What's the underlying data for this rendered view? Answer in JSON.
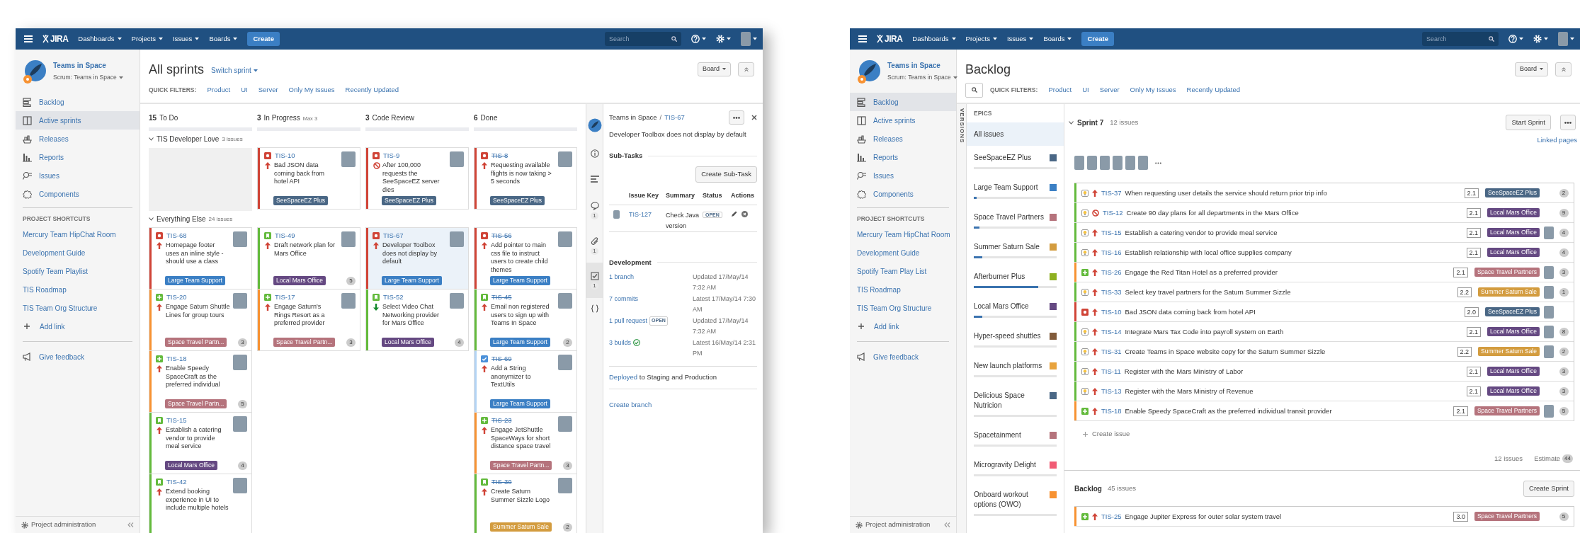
{
  "board_view": {
    "nav": {
      "logo": "JIRA",
      "menus": [
        "Dashboards",
        "Projects",
        "Issues",
        "Boards"
      ],
      "create_button": "Create",
      "search_placeholder": "Search"
    },
    "sidebar": {
      "project_name": "Teams in Space",
      "board_name": "Scrum: Teams in Space",
      "items": [
        {
          "kind": "backlog",
          "label": "Backlog",
          "selected": false
        },
        {
          "kind": "sprints",
          "label": "Active sprints",
          "selected": true
        },
        {
          "kind": "releases",
          "label": "Releases",
          "selected": false
        },
        {
          "kind": "reports",
          "label": "Reports",
          "selected": false
        },
        {
          "kind": "issues",
          "label": "Issues",
          "selected": false
        },
        {
          "kind": "components",
          "label": "Components",
          "selected": false
        }
      ],
      "shortcuts_heading": "PROJECT SHORTCUTS",
      "shortcuts": [
        "Mercury Team HipChat Room",
        "Development Guide",
        "Spotify Team Playlist",
        "TIS Roadmap",
        "TIS Team Org Structure"
      ],
      "add_link": "Add link",
      "feedback": "Give feedback",
      "admin": "Project administration"
    },
    "header": {
      "title": "All sprints",
      "switcher": "Switch sprint",
      "quick_filters_label": "QUICK FILTERS:",
      "quick_filters": [
        "Product",
        "UI",
        "Server",
        "Only My Issues",
        "Recently Updated"
      ],
      "board_button": "Board"
    },
    "columns": [
      {
        "count": "15",
        "name": "To Do"
      },
      {
        "count": "3",
        "name": "In Progress",
        "limit": "Max 3"
      },
      {
        "count": "3",
        "name": "Code Review"
      },
      {
        "count": "6",
        "name": "Done"
      }
    ],
    "swimlanes": [
      {
        "name": "TIS Developer Love",
        "count": "3 issues",
        "expanded": true,
        "cells": [
          [],
          [
            {
              "key": "TIS-10",
              "kind": "bug",
              "priority": {
                "kind": "up"
              },
              "summary": "Bad JSON data coming back from hotel API",
              "epic": {
                "label": "SeeSpaceEZ Plus",
                "color": "#4a6785"
              },
              "color": "#d04437",
              "selected": false,
              "resolved": false
            }
          ],
          [
            {
              "key": "TIS-9",
              "kind": "bug",
              "priority": {
                "kind": "blocker"
              },
              "summary": "After 100,000 requests the SeeSpaceEZ server dies",
              "epic": {
                "label": "SeeSpaceEZ Plus",
                "color": "#4a6785"
              },
              "color": "#d04437",
              "selected": false,
              "resolved": false
            }
          ],
          [
            {
              "key": "TIS-8",
              "kind": "bug",
              "priority": {
                "kind": "up"
              },
              "summary": "Requesting available flights is now taking > 5 seconds",
              "epic": {
                "label": "SeeSpaceEZ Plus",
                "color": "#4a6785"
              },
              "color": "#d04437",
              "selected": false,
              "resolved": true
            }
          ]
        ]
      },
      {
        "name": "Everything Else",
        "count": "24 issues",
        "expanded": true,
        "cells": [
          [
            {
              "key": "TIS-68",
              "kind": "bug",
              "priority": {
                "kind": "up"
              },
              "summary": "Homepage footer uses an inline style - should use a class",
              "epic": {
                "label": "Large Team Support",
                "color": "#3b7fc4"
              },
              "color": "#d04437",
              "selected": false,
              "resolved": false
            },
            {
              "key": "TIS-20",
              "kind": "newfeature",
              "priority": {
                "kind": "up"
              },
              "summary": "Engage Saturn Shuttle Lines for group tours",
              "epic": {
                "label": "Space Travel Partn...",
                "color": "#b5737c"
              },
              "estimate": "3",
              "color": "#f79232",
              "selected": false,
              "resolved": false
            },
            {
              "key": "TIS-18",
              "kind": "newfeature",
              "priority": {
                "kind": "up"
              },
              "summary": "Enable Speedy SpaceCraft as the preferred individual",
              "epic": {
                "label": "Space Travel Partn...",
                "color": "#b5737c"
              },
              "estimate": "5",
              "color": "#f79232",
              "selected": false,
              "resolved": false
            },
            {
              "key": "TIS-15",
              "kind": "story",
              "priority": {
                "kind": "up"
              },
              "summary": "Establish a catering vendor to provide meal service",
              "epic": {
                "label": "Local Mars Office",
                "color": "#654982"
              },
              "estimate": "4",
              "color": "#63ba3c",
              "selected": false,
              "resolved": false
            },
            {
              "key": "TIS-42",
              "kind": "story",
              "priority": {
                "kind": "up"
              },
              "summary": "Extend booking experience in UI to include multiple hotels",
              "color": "#63ba3c",
              "selected": false,
              "resolved": false
            }
          ],
          [
            {
              "key": "TIS-49",
              "kind": "story",
              "priority": {
                "kind": "up"
              },
              "summary": "Draft network plan for Mars Office",
              "epic": {
                "label": "Local Mars Office",
                "color": "#654982"
              },
              "estimate": "5",
              "color": "#63ba3c",
              "selected": false,
              "resolved": false
            },
            {
              "key": "TIS-17",
              "kind": "newfeature",
              "priority": {
                "kind": "up"
              },
              "summary": "Engage Saturn's Rings Resort as a preferred provider",
              "epic": {
                "label": "Space Travel Partn...",
                "color": "#b5737c"
              },
              "estimate": "3",
              "color": "#f79232",
              "selected": false,
              "resolved": false
            }
          ],
          [
            {
              "key": "TIS-67",
              "kind": "bug",
              "priority": {
                "kind": "up"
              },
              "summary": "Developer Toolbox does not display by default",
              "epic": {
                "label": "Large Team Support",
                "color": "#3b7fc4"
              },
              "color": "#d04437",
              "selected": true,
              "resolved": false
            },
            {
              "key": "TIS-52",
              "kind": "story",
              "priority": {
                "kind": "down"
              },
              "summary": "Select Video Chat Networking provider for Mars Office",
              "epic": {
                "label": "Local Mars Office",
                "color": "#654982"
              },
              "estimate": "4",
              "color": "#63ba3c",
              "selected": false,
              "resolved": false
            }
          ],
          [
            {
              "key": "TIS-56",
              "kind": "bug",
              "priority": {
                "kind": "up"
              },
              "summary": "Add pointer to main css file to instruct users to create child themes",
              "epic": {
                "label": "Large Team Support",
                "color": "#3b7fc4"
              },
              "color": "#d04437",
              "selected": false,
              "resolved": true
            },
            {
              "key": "TIS-45",
              "kind": "story",
              "priority": {
                "kind": "up"
              },
              "summary": "Email non registered users to sign up with Teams In Space",
              "epic": {
                "label": "Large Team Support",
                "color": "#3b7fc4"
              },
              "estimate": "2",
              "color": "#63ba3c",
              "selected": false,
              "resolved": true
            },
            {
              "key": "TIS-69",
              "kind": "task",
              "priority": {
                "kind": "up"
              },
              "summary": "Add a String anonymizer to TextUtils",
              "epic": {
                "label": "Large Team Support",
                "color": "#3b7fc4"
              },
              "color": "#b3d4f5",
              "selected": false,
              "resolved": true
            },
            {
              "key": "TIS-23",
              "kind": "newfeature",
              "priority": {
                "kind": "up"
              },
              "summary": "Engage JetShuttle SpaceWays for short distance space travel",
              "epic": {
                "label": "Space Travel Partn...",
                "color": "#b5737c"
              },
              "estimate": "3",
              "color": "#f79232",
              "selected": false,
              "resolved": true
            },
            {
              "key": "TIS-30",
              "kind": "story",
              "priority": {
                "kind": "up"
              },
              "summary": "Create Saturn Summer Sizzle Logo",
              "epic": {
                "label": "Summer Saturn Sale",
                "color": "#d39c3f"
              },
              "estimate": "2",
              "color": "#63ba3c",
              "selected": false,
              "resolved": true
            }
          ]
        ]
      }
    ],
    "detail_tabs": [
      {
        "kind": "avatar",
        "selected": false
      },
      {
        "kind": "info",
        "selected": false
      },
      {
        "kind": "details",
        "selected": false
      },
      {
        "kind": "comments",
        "count": "1",
        "selected": false
      },
      {
        "kind": "attachments",
        "count": "1",
        "selected": false
      },
      {
        "kind": "subtasks",
        "count": "1",
        "selected": true
      },
      {
        "kind": "development",
        "selected": false
      }
    ],
    "detail_panel": {
      "project": "Teams in Space",
      "separator": "/",
      "key": "TIS-67",
      "summary": "Developer Toolbox does not display by default",
      "subtasks_heading": "Sub-Tasks",
      "create_subtask_button": "Create Sub-Task",
      "subtask_columns": [
        "Issue Key",
        "Summary",
        "Status",
        "Actions"
      ],
      "subtasks": [
        {
          "key": "TIS-127",
          "summary": "Check Java version",
          "status": "OPEN"
        }
      ],
      "development_heading": "Development",
      "development": [
        {
          "link": "1 branch",
          "detail": "Updated 17/May/14 7:32 AM"
        },
        {
          "link": "7 commits",
          "detail": "Latest 17/May/14 7:30 AM"
        },
        {
          "link": "1 pull request",
          "badge": "OPEN",
          "detail": "Updated 17/May/14 7:32 AM"
        },
        {
          "link": "3 builds",
          "passed": true,
          "detail": "Latest 16/May/14 2:31 PM"
        }
      ],
      "deployed_link": "Deployed",
      "deployed_text": "to Staging and Production",
      "create_branch": "Create branch"
    }
  },
  "backlog_view": {
    "nav": {
      "logo": "JIRA",
      "menus": [
        "Dashboards",
        "Projects",
        "Issues",
        "Boards"
      ],
      "create_button": "Create",
      "search_placeholder": "Search"
    },
    "sidebar": {
      "project_name": "Teams in Space",
      "board_name": "Scrum: Teams in Space",
      "items": [
        {
          "kind": "backlog",
          "label": "Backlog",
          "selected": true
        },
        {
          "kind": "sprints",
          "label": "Active sprints",
          "selected": false
        },
        {
          "kind": "releases",
          "label": "Releases",
          "selected": false
        },
        {
          "kind": "reports",
          "label": "Reports",
          "selected": false
        },
        {
          "kind": "issues",
          "label": "Issues",
          "selected": false
        },
        {
          "kind": "components",
          "label": "Components",
          "selected": false
        }
      ],
      "shortcuts_heading": "PROJECT SHORTCUTS",
      "shortcuts": [
        "Mercury Team HipChat Room",
        "Development Guide",
        "Spotify Team Play List",
        "TIS Roadmap",
        "TIS Team Org Structure"
      ],
      "add_link": "Add link",
      "feedback": "Give feedback",
      "admin": "Project administration"
    },
    "header": {
      "title": "Backlog",
      "quick_filters_label": "QUICK FILTERS:",
      "quick_filters": [
        "Product",
        "UI",
        "Server",
        "Only My Issues",
        "Recently Updated"
      ],
      "board_button": "Board"
    },
    "versions_label": "VERSIONS",
    "epics": {
      "heading": "EPICS",
      "all_label": "All issues",
      "all_selected": true,
      "items": [
        {
          "name": "SeeSpaceEZ Plus",
          "color": "#4a6785",
          "level": 0
        },
        {
          "name": "Large Team Support",
          "color": "#3b7fc4",
          "level": 0.03
        },
        {
          "name": "Space Travel Partners",
          "color": "#b5737c",
          "level": 0.07
        },
        {
          "name": "Summer Saturn Sale",
          "color": "#d39c3f",
          "level": 0.1
        },
        {
          "name": "Afterburner Plus",
          "color": "#8eb021",
          "level": 0.78
        },
        {
          "name": "Local Mars Office",
          "color": "#654982",
          "level": 0.1
        },
        {
          "name": "Hyper-speed shuttles",
          "color": "#815b3a",
          "level": 0
        },
        {
          "name": "New launch platforms",
          "color": "#e8a33d",
          "level": 0
        },
        {
          "name": "Delicious Space Nutricion",
          "color": "#4a6785",
          "level": 0
        },
        {
          "name": "Spacetainment",
          "color": "#b5737c",
          "level": 0
        },
        {
          "name": "Microgravity Delight",
          "color": "#f15c75",
          "level": 0
        },
        {
          "name": "Onboard workout options (OWO)",
          "color": "#f79232",
          "level": 0
        }
      ]
    },
    "sprint": {
      "name": "Sprint 7",
      "count": "12 issues",
      "expanded": true,
      "start_button": "Start Sprint",
      "linked_pages": "Linked pages",
      "issues": [
        {
          "key": "TIS-37",
          "kind": "idea",
          "priority": {
            "kind": "up"
          },
          "summary": "When requesting user details the service should return prior trip info",
          "version": "2.1",
          "epic": {
            "label": "SeeSpaceEZ Plus",
            "color": "#4a6785"
          },
          "assigned": false,
          "estimate": "2",
          "color": "#63ba3c"
        },
        {
          "key": "TIS-12",
          "kind": "idea",
          "priority": {
            "kind": "blocker"
          },
          "summary": "Create 90 day plans for all departments in the Mars Office",
          "version": "2.1",
          "epic": {
            "label": "Local Mars Office",
            "color": "#654982"
          },
          "assigned": false,
          "estimate": "9",
          "color": "#63ba3c"
        },
        {
          "key": "TIS-15",
          "kind": "idea",
          "priority": {
            "kind": "up"
          },
          "summary": "Establish a catering vendor to provide meal service",
          "version": "2.1",
          "epic": {
            "label": "Local Mars Office",
            "color": "#654982"
          },
          "assigned": true,
          "estimate": "4",
          "color": "#63ba3c"
        },
        {
          "key": "TIS-16",
          "kind": "idea",
          "priority": {
            "kind": "up"
          },
          "summary": "Establish relationship with local office supplies company",
          "version": "2.1",
          "epic": {
            "label": "Local Mars Office",
            "color": "#654982"
          },
          "assigned": false,
          "estimate": "4",
          "color": "#63ba3c"
        },
        {
          "key": "TIS-26",
          "kind": "newfeature",
          "priority": {
            "kind": "up"
          },
          "summary": "Engage the Red Titan Hotel as a preferred provider",
          "version": "2.1",
          "epic": {
            "label": "Space Travel Partners",
            "color": "#b5737c"
          },
          "assigned": true,
          "estimate": "3",
          "color": "#f79232"
        },
        {
          "key": "TIS-33",
          "kind": "idea",
          "priority": {
            "kind": "up"
          },
          "summary": "Select key travel partners for the Saturn Summer Sizzle",
          "version": "2.2",
          "epic": {
            "label": "Summer Saturn Sale",
            "color": "#d39c3f"
          },
          "assigned": true,
          "estimate": "1",
          "color": "#63ba3c"
        },
        {
          "key": "TIS-10",
          "kind": "bug",
          "priority": {
            "kind": "up"
          },
          "summary": "Bad JSON data coming back from hotel API",
          "version": "2.0",
          "epic": {
            "label": "SeeSpaceEZ Plus",
            "color": "#4a6785"
          },
          "assigned": true,
          "color": "#d04437"
        },
        {
          "key": "TIS-14",
          "kind": "idea",
          "priority": {
            "kind": "up"
          },
          "summary": "Integrate Mars Tax Code into payroll system on Earth",
          "version": "2.1",
          "epic": {
            "label": "Local Mars Office",
            "color": "#654982"
          },
          "assigned": true,
          "estimate": "8",
          "color": "#63ba3c"
        },
        {
          "key": "TIS-31",
          "kind": "idea",
          "priority": {
            "kind": "up"
          },
          "summary": "Create Teams in Space website copy for the Saturn Summer Sizzle",
          "version": "2.2",
          "epic": {
            "label": "Summer Saturn Sale",
            "color": "#d39c3f"
          },
          "assigned": true,
          "estimate": "2",
          "color": "#63ba3c"
        },
        {
          "key": "TIS-11",
          "kind": "idea",
          "priority": {
            "kind": "up"
          },
          "summary": "Register with the Mars Ministry of Labor",
          "version": "2.1",
          "epic": {
            "label": "Local Mars Office",
            "color": "#654982"
          },
          "assigned": false,
          "estimate": "3",
          "color": "#63ba3c"
        },
        {
          "key": "TIS-13",
          "kind": "idea",
          "priority": {
            "kind": "up"
          },
          "summary": "Register with the Mars Ministry of Revenue",
          "version": "2.1",
          "epic": {
            "label": "Local Mars Office",
            "color": "#654982"
          },
          "assigned": false,
          "estimate": "3",
          "color": "#63ba3c"
        },
        {
          "key": "TIS-18",
          "kind": "newfeature",
          "priority": {
            "kind": "up"
          },
          "summary": "Enable Speedy SpaceCraft as the preferred individual transit provider",
          "version": "2.1",
          "epic": {
            "label": "Space Travel Partners",
            "color": "#b5737c"
          },
          "assigned": true,
          "estimate": "5",
          "color": "#f79232"
        }
      ],
      "create_issue": "Create issue",
      "footer_count": "12 issues",
      "estimate_label": "Estimate",
      "estimate_total": "44"
    },
    "backlog": {
      "name": "Backlog",
      "count": "45 issues",
      "create_button": "Create Sprint",
      "issues": [
        {
          "key": "TIS-25",
          "kind": "newfeature",
          "priority": {
            "kind": "up"
          },
          "summary": "Engage Jupiter Express for outer solar system travel",
          "version": "3.0",
          "epic": {
            "label": "Space Travel Partners",
            "color": "#b5737c"
          },
          "assigned": false,
          "estimate": "5",
          "color": "#f79232"
        }
      ]
    }
  }
}
